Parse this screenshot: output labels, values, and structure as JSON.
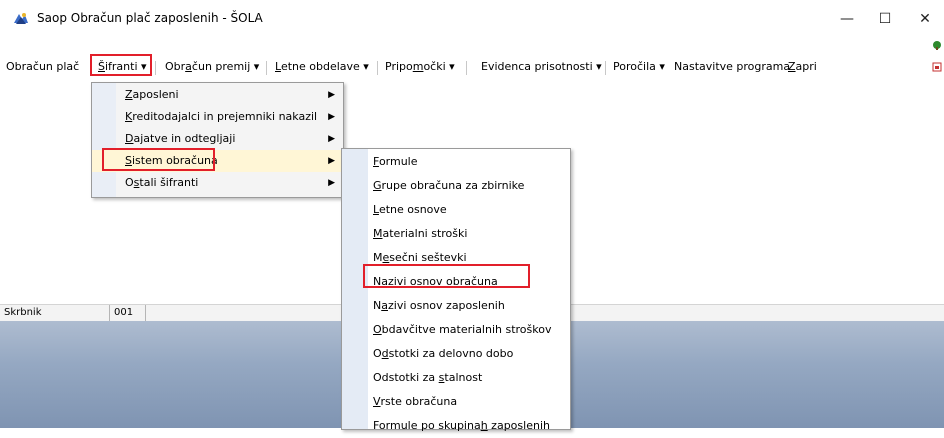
{
  "window": {
    "title": "Saop Obračun plač zaposlenih  - ŠOLA",
    "minimize_glyph": "—",
    "maximize_glyph": "☐",
    "close_glyph": "✕"
  },
  "menubar": {
    "items": [
      {
        "label": "Obračun plač",
        "pre": "",
        "ul": "",
        "post": ""
      },
      {
        "pre": "",
        "ul": "Š",
        "post": "ifranti ▾"
      },
      {
        "pre": "Obr",
        "ul": "a",
        "post": "čun premij ▾"
      },
      {
        "pre": "",
        "ul": "L",
        "post": "etne obdelave ▾"
      },
      {
        "pre": "Pripo",
        "ul": "m",
        "post": "očki ▾"
      },
      {
        "pre": "Evidenca prisotnosti ▾",
        "ul": "",
        "post": ""
      },
      {
        "pre": "Poročila ▾",
        "ul": "",
        "post": ""
      },
      {
        "pre": "Nastavitve programa",
        "ul": "",
        "post": ""
      },
      {
        "pre": "",
        "ul": "Z",
        "post": "apri"
      }
    ]
  },
  "sifranti_menu": {
    "items": [
      {
        "pre": "",
        "ul": "Z",
        "post": "aposleni",
        "has_submenu": true
      },
      {
        "pre": "",
        "ul": "K",
        "post": "reditodajalci in prejemniki nakazil",
        "has_submenu": true
      },
      {
        "pre": "",
        "ul": "D",
        "post": "ajatve in odtegljaji",
        "has_submenu": true
      },
      {
        "pre": "",
        "ul": "S",
        "post": "istem obračuna",
        "has_submenu": true
      },
      {
        "pre": "O",
        "ul": "s",
        "post": "tali šifranti",
        "has_submenu": true
      }
    ]
  },
  "sistem_obracuna_submenu": {
    "items": [
      {
        "pre": "",
        "ul": "F",
        "post": "ormule"
      },
      {
        "pre": "",
        "ul": "G",
        "post": "rupe obračuna za zbirnike"
      },
      {
        "pre": "",
        "ul": "L",
        "post": "etne osnove"
      },
      {
        "pre": "",
        "ul": "M",
        "post": "aterialni stroški"
      },
      {
        "pre": "M",
        "ul": "e",
        "post": "sečni seštevki"
      },
      {
        "pre": "",
        "ul": "N",
        "post": "azivi osnov obračuna"
      },
      {
        "pre": "N",
        "ul": "a",
        "post": "zivi osnov zaposlenih"
      },
      {
        "pre": "",
        "ul": "O",
        "post": "bdavčitve materialnih stroškov"
      },
      {
        "pre": "O",
        "ul": "d",
        "post": "stotki za delovno dobo"
      },
      {
        "pre": "Odstotki za ",
        "ul": "s",
        "post": "talnost"
      },
      {
        "pre": "",
        "ul": "V",
        "post": "rste obračuna"
      },
      {
        "pre": "Formule po skupina",
        "ul": "h",
        "post": " zaposlenih"
      }
    ]
  },
  "statusbar": {
    "field1": "Skrbnik",
    "field2": "001"
  },
  "colors": {
    "highlight_border": "#e21f2a",
    "active_item": "#fff6d6",
    "bottom_area": "#95a8c2"
  }
}
